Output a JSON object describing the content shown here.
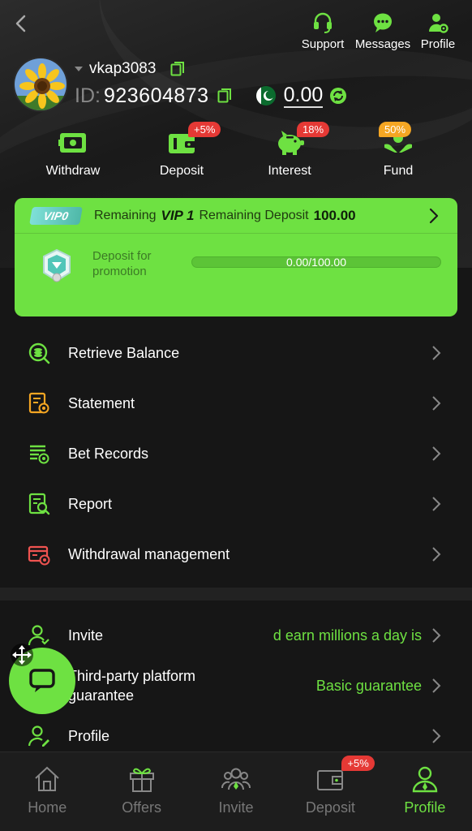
{
  "top_actions": [
    {
      "label": "Support",
      "icon": "headset-icon"
    },
    {
      "label": "Messages",
      "icon": "chat-bubble-icon"
    },
    {
      "label": "Profile",
      "icon": "user-gear-icon"
    }
  ],
  "user": {
    "username": "vkap3083",
    "id_label": "ID:",
    "id_value": "923604873",
    "balance": "0.00"
  },
  "quick_actions": [
    {
      "label": "Withdraw",
      "icon": "withdraw-icon",
      "badge": ""
    },
    {
      "label": "Deposit",
      "icon": "wallet-icon",
      "badge": "+5%"
    },
    {
      "label": "Interest",
      "icon": "piggy-bank-icon",
      "badge": "18%"
    },
    {
      "label": "Fund",
      "icon": "hands-coin-icon",
      "badge": "50%"
    }
  ],
  "vip": {
    "badge": "VIP0",
    "remaining_label": "Remaining",
    "level": "VIP 1",
    "remaining_deposit_label": "Remaining Deposit",
    "remaining_deposit_amount": "100.00",
    "promo_text": "Deposit for promotion",
    "progress_text": "0.00/100.00",
    "progress_fraction": 0.0
  },
  "menu": [
    {
      "label": "Retrieve Balance",
      "icon": "retrieve-balance-icon"
    },
    {
      "label": "Statement",
      "icon": "statement-icon"
    },
    {
      "label": "Bet Records",
      "icon": "bet-records-icon"
    },
    {
      "label": "Report",
      "icon": "report-icon"
    },
    {
      "label": "Withdrawal management",
      "icon": "withdrawal-management-icon"
    }
  ],
  "menu2": [
    {
      "label": "Invite",
      "right_text": "d earn millions a day is"
    },
    {
      "label": "Third-party platform guarantee",
      "right_text": "Basic guarantee"
    },
    {
      "label": "Profile",
      "right_text": ""
    }
  ],
  "tabs": [
    {
      "label": "Home",
      "icon": "home-icon",
      "badge": ""
    },
    {
      "label": "Offers",
      "icon": "gift-icon",
      "badge": ""
    },
    {
      "label": "Invite",
      "icon": "users-icon",
      "badge": ""
    },
    {
      "label": "Deposit",
      "icon": "wallet-icon",
      "badge": "+5%"
    },
    {
      "label": "Profile",
      "icon": "user-icon",
      "badge": ""
    }
  ],
  "colors": {
    "accent": "#6ee142",
    "badge_red": "#e53935",
    "badge_orange": "#f5a623",
    "background": "#161616"
  }
}
